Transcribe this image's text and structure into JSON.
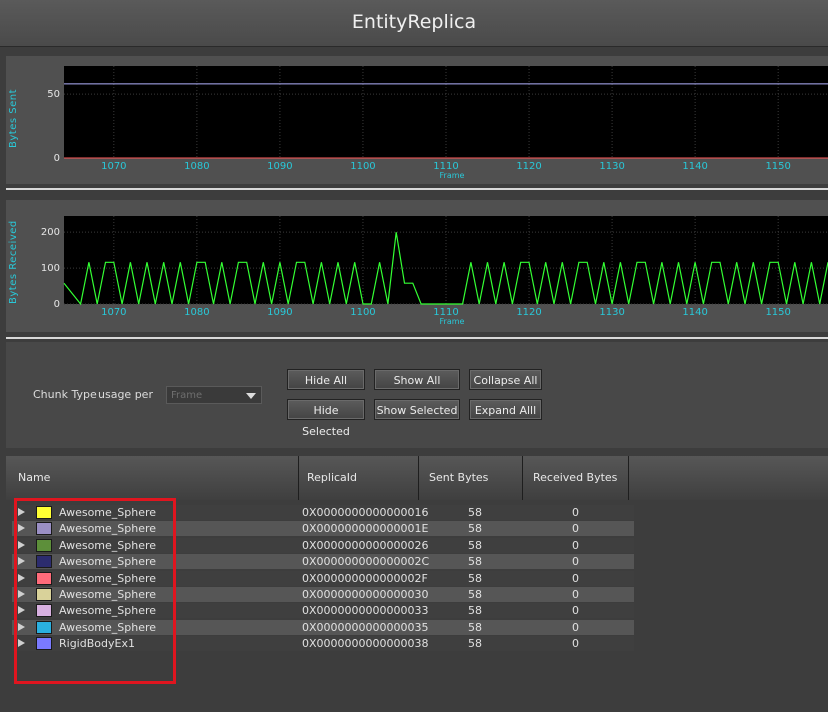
{
  "window": {
    "title": "EntityReplica"
  },
  "charts": [
    {
      "ylabel": "Bytes Sent",
      "xlabel": "Frame",
      "xticks": [
        "1070",
        "1080",
        "1090",
        "1100",
        "1110",
        "1120",
        "1130",
        "1140",
        "1150"
      ],
      "yticks": [
        "0",
        "50"
      ]
    },
    {
      "ylabel": "Bytes Received",
      "xlabel": "Frame",
      "xticks": [
        "1070",
        "1080",
        "1090",
        "1100",
        "1110",
        "1120",
        "1130",
        "1140",
        "1150"
      ],
      "yticks": [
        "0",
        "100",
        "200"
      ]
    }
  ],
  "chart_data": [
    {
      "type": "line",
      "ylabel": "Bytes Sent",
      "xlabel": "Frame",
      "xlim": [
        1064,
        1156
      ],
      "ylim": [
        0,
        72
      ],
      "series": [
        {
          "color": "#b3b3ff",
          "x": [
            1064,
            1156
          ],
          "y": [
            58,
            58
          ]
        },
        {
          "color": "#ff5a5a",
          "x": [
            1064,
            1156
          ],
          "y": [
            0,
            0
          ]
        }
      ]
    },
    {
      "type": "line",
      "ylabel": "Bytes Received",
      "xlabel": "Frame",
      "xlim": [
        1064,
        1156
      ],
      "ylim": [
        0,
        245
      ],
      "series": [
        {
          "color": "#33ff33",
          "x": [
            1064,
            1066,
            1067,
            1068,
            1069,
            1070,
            1071,
            1072,
            1073,
            1074,
            1075,
            1076,
            1077,
            1078,
            1079,
            1080,
            1081,
            1082,
            1083,
            1084,
            1085,
            1086,
            1087,
            1088,
            1089,
            1090,
            1091,
            1092,
            1093,
            1094,
            1095,
            1096,
            1097,
            1098,
            1099,
            1100,
            1101,
            1102,
            1103,
            1104,
            1105,
            1106,
            1107,
            1108,
            1109,
            1110,
            1111,
            1112,
            1113,
            1114,
            1115,
            1116,
            1117,
            1118,
            1119,
            1120,
            1121,
            1122,
            1123,
            1124,
            1125,
            1126,
            1127,
            1128,
            1129,
            1130,
            1131,
            1132,
            1133,
            1134,
            1135,
            1136,
            1137,
            1138,
            1139,
            1140,
            1141,
            1142,
            1143,
            1144,
            1145,
            1146,
            1147,
            1148,
            1149,
            1150,
            1151,
            1152,
            1153,
            1154,
            1155,
            1156
          ],
          "y": [
            58,
            0,
            116,
            0,
            116,
            116,
            0,
            116,
            0,
            116,
            0,
            116,
            0,
            116,
            0,
            116,
            116,
            0,
            116,
            0,
            116,
            116,
            0,
            116,
            0,
            116,
            0,
            116,
            116,
            0,
            116,
            0,
            116,
            0,
            116,
            0,
            0,
            116,
            0,
            200,
            58,
            58,
            0,
            0,
            0,
            0,
            0,
            0,
            116,
            0,
            116,
            0,
            116,
            0,
            116,
            116,
            0,
            116,
            0,
            116,
            0,
            116,
            116,
            0,
            116,
            0,
            116,
            0,
            116,
            116,
            0,
            116,
            0,
            116,
            0,
            116,
            0,
            116,
            116,
            0,
            116,
            0,
            116,
            0,
            116,
            116,
            0,
            116,
            0,
            116,
            0,
            116
          ]
        }
      ]
    }
  ],
  "controls": {
    "chunk_type_label": "Chunk Type",
    "usage_per_label": "usage per",
    "usage_per_value": "Frame",
    "buttons": {
      "hide_all": "Hide All",
      "show_all": "Show All",
      "collapse_all": "Collapse All",
      "hide_selected": "Hide Selected",
      "show_selected": "Show Selected",
      "expand_all": "Expand Alll"
    }
  },
  "table": {
    "headers": [
      "Name",
      "ReplicaId",
      "Sent Bytes",
      "Received Bytes"
    ],
    "rows": [
      {
        "color": "#ffff33",
        "name": "Awesome_Sphere",
        "replica_id": "0X0000000000000016",
        "sent": "58",
        "received": "0"
      },
      {
        "color": "#9a8fc4",
        "name": "Awesome_Sphere",
        "replica_id": "0X000000000000001E",
        "sent": "58",
        "received": "0"
      },
      {
        "color": "#5d8f3a",
        "name": "Awesome_Sphere",
        "replica_id": "0X0000000000000026",
        "sent": "58",
        "received": "0"
      },
      {
        "color": "#2c2c6e",
        "name": "Awesome_Sphere",
        "replica_id": "0X000000000000002C",
        "sent": "58",
        "received": "0"
      },
      {
        "color": "#ff6b7a",
        "name": "Awesome_Sphere",
        "replica_id": "0X000000000000002F",
        "sent": "58",
        "received": "0"
      },
      {
        "color": "#d9d29a",
        "name": "Awesome_Sphere",
        "replica_id": "0X0000000000000030",
        "sent": "58",
        "received": "0"
      },
      {
        "color": "#d8b0e0",
        "name": "Awesome_Sphere",
        "replica_id": "0X0000000000000033",
        "sent": "58",
        "received": "0"
      },
      {
        "color": "#2ab0e0",
        "name": "Awesome_Sphere",
        "replica_id": "0X0000000000000035",
        "sent": "58",
        "received": "0"
      },
      {
        "color": "#7a7aff",
        "name": "RigidBodyEx1",
        "replica_id": "0X0000000000000038",
        "sent": "58",
        "received": "0"
      }
    ]
  }
}
